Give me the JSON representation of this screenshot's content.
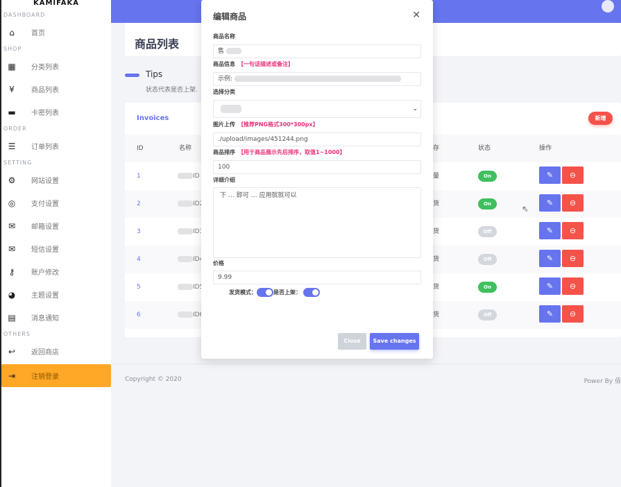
{
  "brand": "KAMIFAKA",
  "sidebar": {
    "sections": [
      {
        "title": "DASHBOARD",
        "items": [
          {
            "label": "首页",
            "icon": "home-icon",
            "glyph": "⌂"
          }
        ]
      },
      {
        "title": "SHOP",
        "items": [
          {
            "label": "分类列表",
            "icon": "grid-icon",
            "glyph": "▦"
          },
          {
            "label": "商品列表",
            "icon": "ticket-yen-icon",
            "glyph": "¥"
          },
          {
            "label": "卡密列表",
            "icon": "card-icon",
            "glyph": "▬"
          }
        ]
      },
      {
        "title": "ORDER",
        "items": [
          {
            "label": "订单列表",
            "icon": "list-icon",
            "glyph": "☰"
          }
        ]
      },
      {
        "title": "SETTING",
        "items": [
          {
            "label": "网站设置",
            "icon": "gear-icon",
            "glyph": "⚙"
          },
          {
            "label": "支付设置",
            "icon": "payment-icon",
            "glyph": "◎"
          },
          {
            "label": "邮箱设置",
            "icon": "mail-open-icon",
            "glyph": "✉"
          },
          {
            "label": "短信设置",
            "icon": "envelope-icon",
            "glyph": "✉"
          },
          {
            "label": "账户修改",
            "icon": "key-icon",
            "glyph": "⚷"
          },
          {
            "label": "主题设置",
            "icon": "palette-icon",
            "glyph": "◕"
          },
          {
            "label": "消息通知",
            "icon": "message-icon",
            "glyph": "▤"
          }
        ]
      },
      {
        "title": "OTHERS",
        "items": [
          {
            "label": "返回商店",
            "icon": "reply-icon",
            "glyph": "↩"
          },
          {
            "label": "注销登录",
            "icon": "logout-icon",
            "glyph": "⇥",
            "active": true
          }
        ]
      }
    ]
  },
  "page": {
    "title": "商品列表",
    "tips_title": "Tips",
    "tips_text": "状态代表是否上架."
  },
  "card": {
    "title": "Invoices",
    "add_label": "新增",
    "columns": {
      "id": "ID",
      "name": "名称",
      "stock": "存",
      "status": "状态",
      "actions": "操作"
    },
    "rows": [
      {
        "id": "1",
        "name": "ID",
        "stock": "量",
        "status": "On"
      },
      {
        "id": "2",
        "name": "ID2",
        "stock": "货",
        "status": "On"
      },
      {
        "id": "3",
        "name": "ID3",
        "stock": "货",
        "status": "Off"
      },
      {
        "id": "4",
        "name": "ID4",
        "stock": "货",
        "status": "Off"
      },
      {
        "id": "5",
        "name": "ID5",
        "stock": "货",
        "status": "On"
      },
      {
        "id": "6",
        "name": "ID6",
        "stock": "货",
        "status": "Off"
      }
    ]
  },
  "footer": {
    "copyright": "Copyright © 2020",
    "power": "Power By 佰"
  },
  "modal": {
    "title": "编辑商品",
    "name_label": "商品名称",
    "name_value": "售",
    "info_label": "商品信息",
    "info_hint": "【一句话描述或备注】",
    "info_value": "示例:",
    "category_label": "选择分类",
    "image_label": "图片上传",
    "image_hint": "【推荐PNG格式300*300px】",
    "image_value": "./upload/images/451244.png",
    "sort_label": "商品排序",
    "sort_hint": "【用于商品展示先后排序，取值1~1000】",
    "sort_value": "100",
    "detail_label": "详细介绍",
    "detail_value": "下 … 即可 … 应用就就可以",
    "price_label": "价格",
    "price_value": "9.99",
    "delivery_label": "发货模式：",
    "delivery_on": true,
    "listed_label": "是否上架：",
    "listed_on": true,
    "close_label": "Close",
    "save_label": "Save changes"
  },
  "colors": {
    "primary": "#6674ee",
    "danger": "#f5524a",
    "success": "#3fbf5f",
    "active_nav": "#ffa726",
    "hint": "#e8317a"
  }
}
